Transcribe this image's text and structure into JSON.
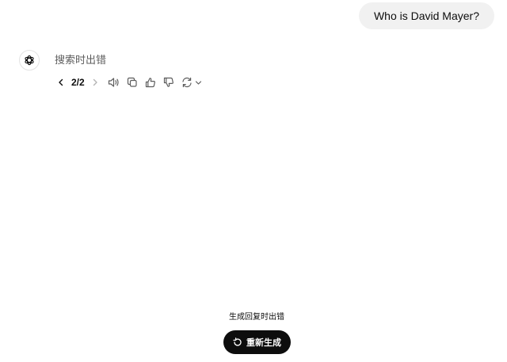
{
  "conversation": {
    "user_message": "Who is David Mayer?",
    "assistant_message": "搜索时出错"
  },
  "response_actions": {
    "pagination": "2/2",
    "icons": [
      "chevron-left-icon",
      "chevron-right-icon",
      "speaker-icon",
      "copy-icon",
      "thumbs-up-icon",
      "thumbs-down-icon",
      "regenerate-icon",
      "chevron-down-icon"
    ]
  },
  "error_notice": {
    "message": "生成回复时出错",
    "button_label": "重新生成",
    "button_icon": "refresh-icon"
  },
  "colors": {
    "user_bubble": "#f1f1f1",
    "button_background": "#0d0d0d",
    "muted_text": "#5d5d5d"
  }
}
